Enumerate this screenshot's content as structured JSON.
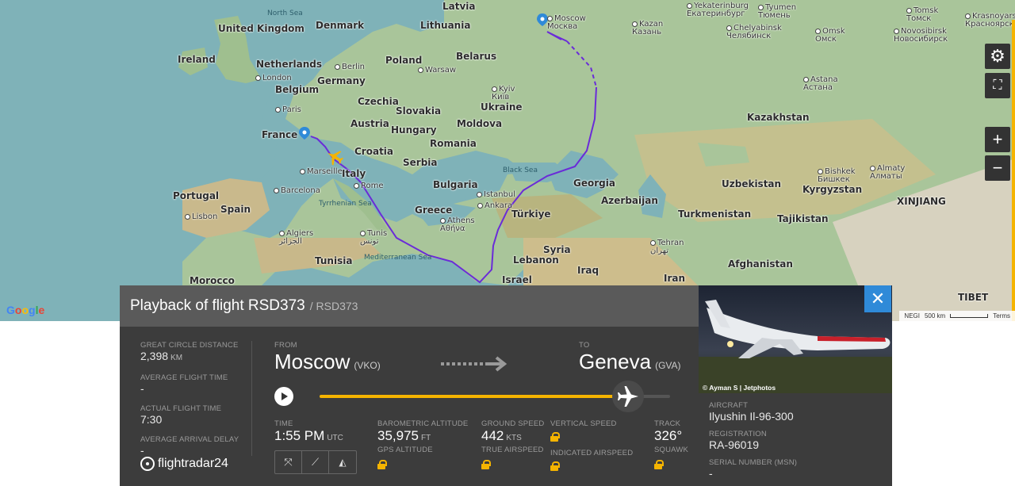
{
  "map": {
    "countries": [
      {
        "name": "United Kingdom"
      },
      {
        "name": "Ireland"
      },
      {
        "name": "Netherlands"
      },
      {
        "name": "Belgium"
      },
      {
        "name": "France"
      },
      {
        "name": "Denmark"
      },
      {
        "name": "Germany"
      },
      {
        "name": "Czechia"
      },
      {
        "name": "Austria"
      },
      {
        "name": "Poland"
      },
      {
        "name": "Lithuania"
      },
      {
        "name": "Latvia"
      },
      {
        "name": "Belarus"
      },
      {
        "name": "Ukraine"
      },
      {
        "name": "Slovakia"
      },
      {
        "name": "Hungary"
      },
      {
        "name": "Moldova"
      },
      {
        "name": "Romania"
      },
      {
        "name": "Croatia"
      },
      {
        "name": "Serbia"
      },
      {
        "name": "Bulgaria"
      },
      {
        "name": "Italy"
      },
      {
        "name": "Greece"
      },
      {
        "name": "Portugal"
      },
      {
        "name": "Spain"
      },
      {
        "name": "Tunisia"
      },
      {
        "name": "Morocco"
      },
      {
        "name": "Türkiye"
      },
      {
        "name": "Syria"
      },
      {
        "name": "Lebanon"
      },
      {
        "name": "Israel"
      },
      {
        "name": "Iraq"
      },
      {
        "name": "Iran"
      },
      {
        "name": "Georgia"
      },
      {
        "name": "Azerbaijan"
      },
      {
        "name": "Kazakhstan"
      },
      {
        "name": "Uzbekistan"
      },
      {
        "name": "Turkmenistan"
      },
      {
        "name": "Kyrgyzstan"
      },
      {
        "name": "Tajikistan"
      },
      {
        "name": "Afghanistan"
      },
      {
        "name": "XINJIANG"
      },
      {
        "name": "TIBET"
      }
    ],
    "cities": [
      {
        "name": "London"
      },
      {
        "name": "Paris"
      },
      {
        "name": "Berlin"
      },
      {
        "name": "Warsaw"
      },
      {
        "name": "Kyiv\nКиїв"
      },
      {
        "name": "Moscow\nМосква"
      },
      {
        "name": "Kazan\nКазань"
      },
      {
        "name": "Chelyabinsk\nЧелябинск"
      },
      {
        "name": "Yekaterinburg\nЕкатеринбург"
      },
      {
        "name": "Tyumen\nТюмень"
      },
      {
        "name": "Omsk\nОмск"
      },
      {
        "name": "Tomsk\nТомск"
      },
      {
        "name": "Novosibirsk\nНовосибирск"
      },
      {
        "name": "Krasnoyarsk\nКрасноярск"
      },
      {
        "name": "Astana\nАстана"
      },
      {
        "name": "Bishkek\nБишкек"
      },
      {
        "name": "Almaty\nАлматы"
      },
      {
        "name": "Marseille"
      },
      {
        "name": "Barcelona"
      },
      {
        "name": "Lisbon"
      },
      {
        "name": "Rome"
      },
      {
        "name": "Algiers\nالجزائر"
      },
      {
        "name": "Tunis\nتونس"
      },
      {
        "name": "Istanbul"
      },
      {
        "name": "Ankara"
      },
      {
        "name": "Athens\nΑθήνα"
      },
      {
        "name": "Tehran\nتهران"
      }
    ],
    "seas": [
      {
        "name": "North Sea"
      },
      {
        "name": "Black Sea"
      },
      {
        "name": "Tyrrhenian Sea"
      },
      {
        "name": "Mediterranean Sea"
      }
    ],
    "google_logo": "Google",
    "footer": {
      "data_label": "NEGI",
      "scale": "500 km",
      "terms": "Terms"
    },
    "controls": {
      "settings_icon": "gear-icon",
      "fullscreen_icon": "expand-icon",
      "zoom_in": "+",
      "zoom_out": "−"
    },
    "accent_color": "#f5b400",
    "route_color": "#6a2bd8"
  },
  "panel": {
    "title": "Playback of flight RSD373",
    "callsign": "/ RSD373",
    "stats": {
      "great_circle_label": "GREAT CIRCLE DISTANCE",
      "great_circle_value": "2,398",
      "great_circle_unit": "KM",
      "avg_flight_time_label": "AVERAGE FLIGHT TIME",
      "avg_flight_time_value": "-",
      "actual_flight_time_label": "ACTUAL FLIGHT TIME",
      "actual_flight_time_value": "7:30",
      "avg_arrival_delay_label": "AVERAGE ARRIVAL DELAY",
      "avg_arrival_delay_value": "-"
    },
    "logo": "flightradar24",
    "route": {
      "from_label": "FROM",
      "from_city": "Moscow",
      "from_code": "(VKO)",
      "to_label": "TO",
      "to_city": "Geneva",
      "to_code": "(GVA)"
    },
    "playback": {
      "progress": 0.88
    },
    "telemetry": {
      "time_label": "TIME",
      "time_value": "1:55 PM",
      "time_unit": "UTC",
      "baro_alt_label": "BAROMETRIC ALTITUDE",
      "baro_alt_value": "35,975",
      "baro_alt_unit": "FT",
      "gps_alt_label": "GPS ALTITUDE",
      "ground_speed_label": "GROUND SPEED",
      "ground_speed_value": "442",
      "ground_speed_unit": "KTS",
      "true_airspeed_label": "TRUE AIRSPEED",
      "vertical_speed_label": "VERTICAL SPEED",
      "indicated_airspeed_label": "INDICATED AIRSPEED",
      "track_label": "TRACK",
      "track_value": "326°",
      "squawk_label": "SQUAWK"
    },
    "aircraft": {
      "photo_credit": "© Ayman S | Jetphotos",
      "aircraft_label": "AIRCRAFT",
      "aircraft_value": "Ilyushin Il-96-300",
      "registration_label": "REGISTRATION",
      "registration_value": "RA-96019",
      "serial_label": "SERIAL NUMBER (MSN)",
      "serial_value": "-"
    }
  }
}
